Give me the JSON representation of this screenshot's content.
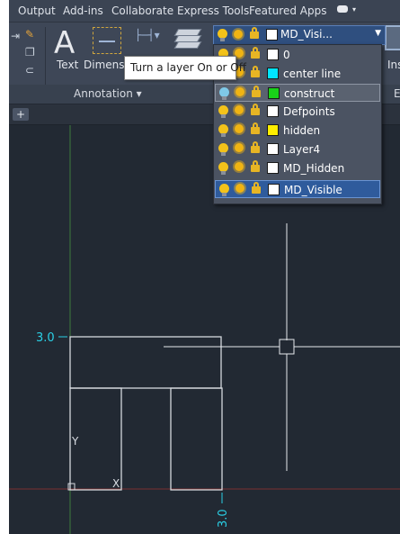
{
  "menu": {
    "items": [
      "Output",
      "Add-ins",
      "Collaborate",
      "Express Tools",
      "Featured Apps"
    ]
  },
  "ribbon": {
    "text_label": "Text",
    "dimension_label": "Dimension",
    "panel_label": "Annotation ▾",
    "insert_label": "Ins",
    "right_panel_letter": "E"
  },
  "layer_dropdown": {
    "current_layer": "MD_Visi...",
    "layers": [
      {
        "name": "0",
        "color": "#ffffff"
      },
      {
        "name": "center line",
        "color": "#00e5ff"
      },
      {
        "name": "construct",
        "color": "#19d219"
      },
      {
        "name": "Defpoints",
        "color": "#ffffff"
      },
      {
        "name": "hidden",
        "color": "#ffee00"
      },
      {
        "name": "Layer4",
        "color": "#ffffff"
      },
      {
        "name": "MD_Hidden",
        "color": "#ffffff"
      },
      {
        "name": "MD_Visible",
        "color": "#ffffff"
      }
    ],
    "hovered_layer": "construct",
    "selected_layer": "MD_Visible"
  },
  "tooltip": {
    "text": "Turn a layer On or Off"
  },
  "drawing": {
    "dimension_left": "3.0",
    "dimension_bottom": "3.0",
    "ucs_y_label": "Y",
    "ucs_x_label": "X"
  }
}
